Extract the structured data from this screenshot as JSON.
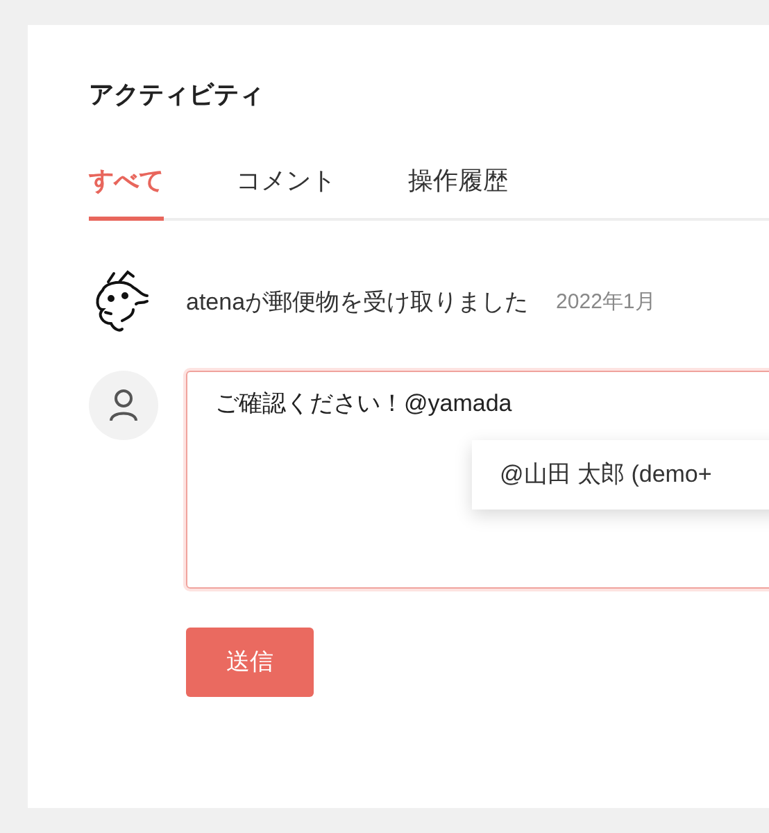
{
  "title": "アクティビティ",
  "tabs": [
    {
      "label": "すべて",
      "selected": true
    },
    {
      "label": "コメント",
      "selected": false
    },
    {
      "label": "操作履歴",
      "selected": false
    }
  ],
  "activity": {
    "message": "atenaが郵便物を受け取りました",
    "date": "2022年1月"
  },
  "comment": {
    "value": "ご確認ください！@yamada",
    "suggestion": "@山田 太郎 (demo+"
  },
  "submit": "送信"
}
